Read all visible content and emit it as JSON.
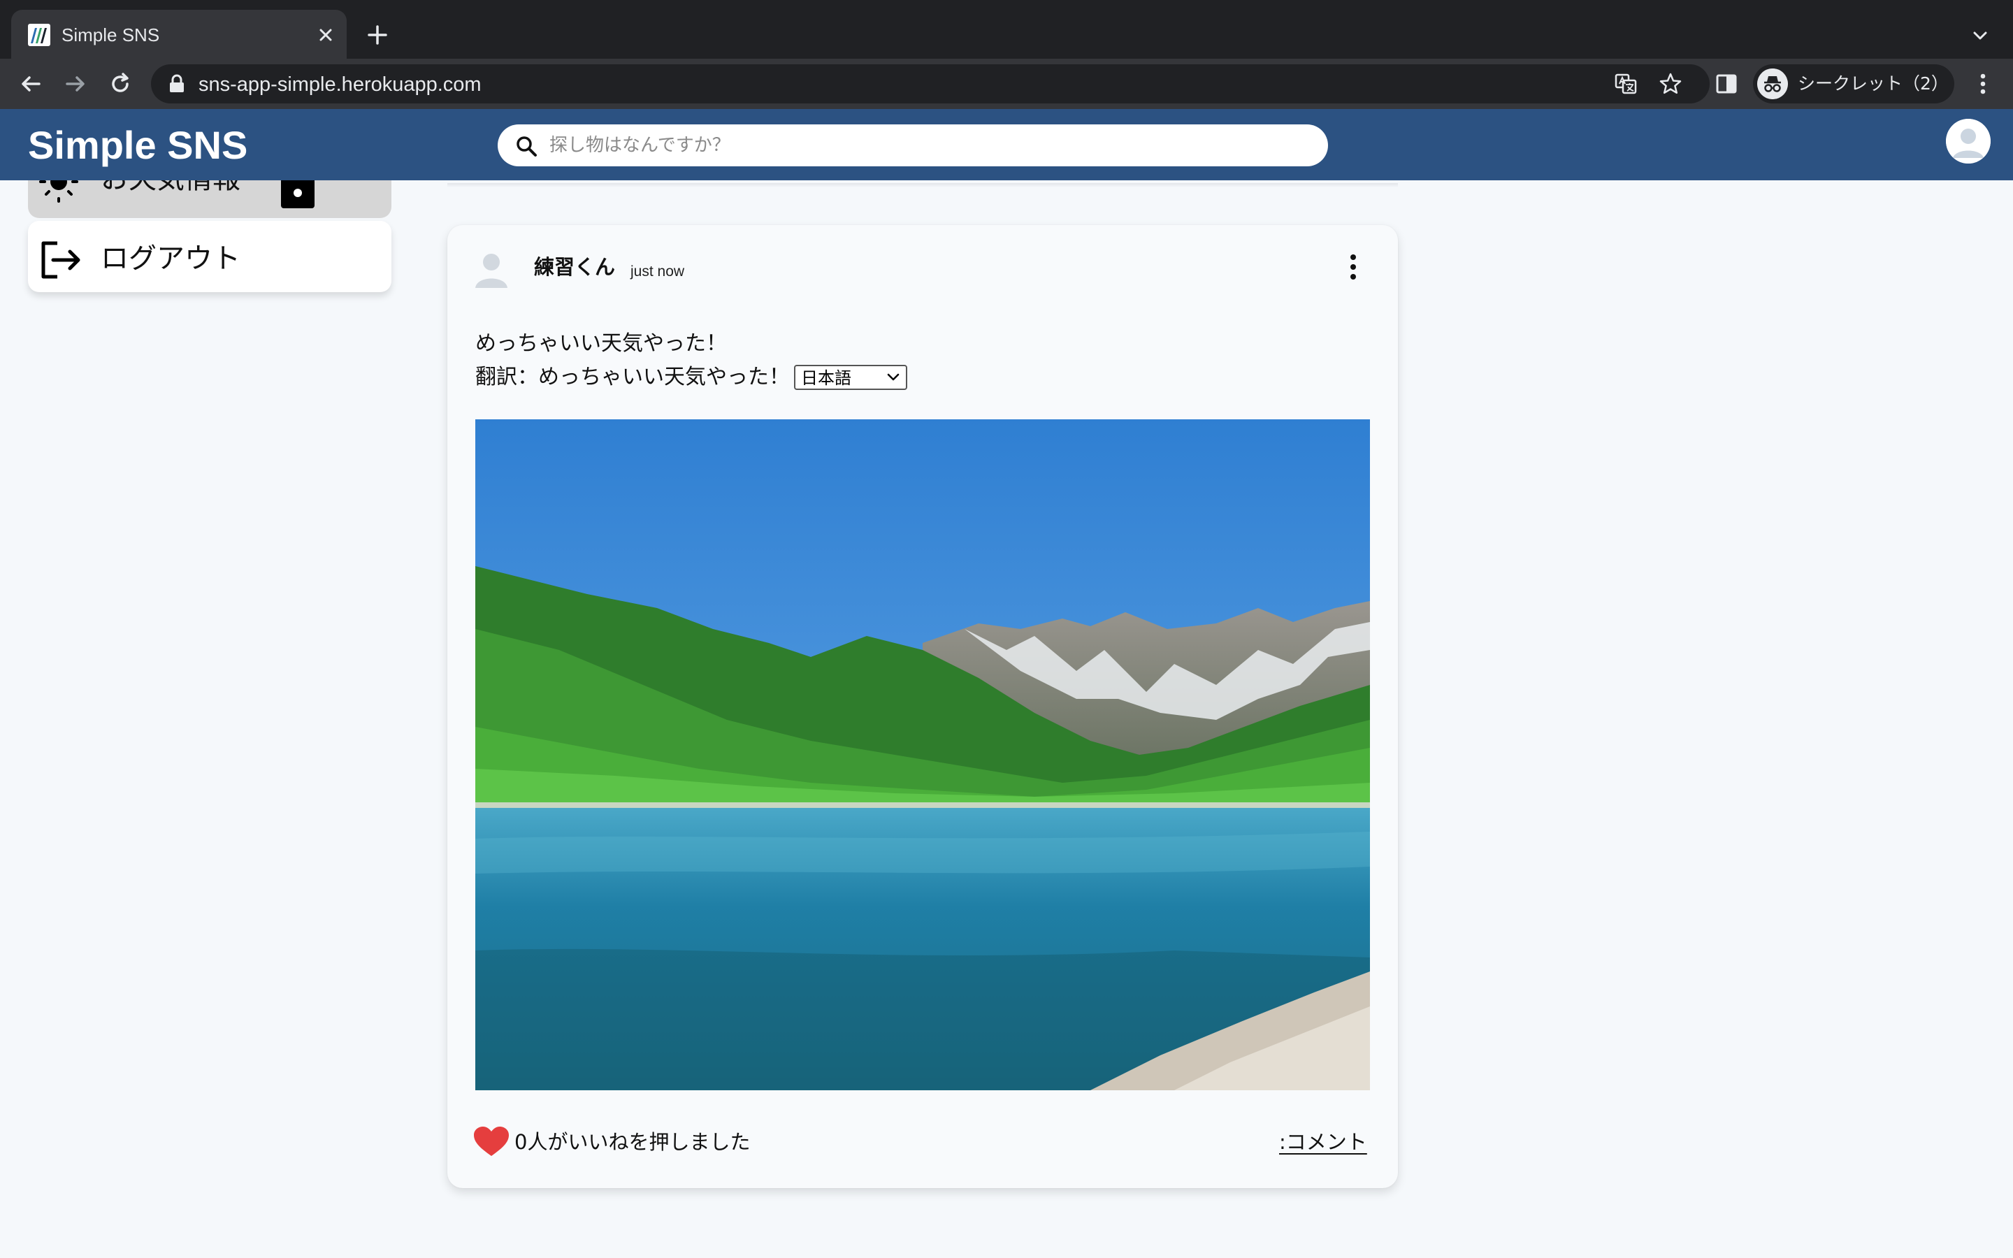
{
  "browser": {
    "tab_title": "Simple SNS",
    "url": "sns-app-simple.herokuapp.com",
    "incognito_label": "シークレット（2）"
  },
  "header": {
    "brand": "Simple SNS",
    "search_placeholder": "探し物はなんですか？",
    "accent_color": "#2c5282"
  },
  "sidebar": {
    "items": [
      {
        "label": "お天気情報",
        "icon": "sun-icon"
      },
      {
        "label": "ログアウト",
        "icon": "logout-icon"
      }
    ]
  },
  "post": {
    "author": "練習くん",
    "time": "just now",
    "text": "めっちゃいい天気やった！",
    "translation_label": "翻訳：めっちゃいい天気やった！",
    "language_selected": "日本語",
    "likes_text": "0人がいいねを押しました",
    "comment_link": ":コメント",
    "photo": "mountain-lake-photo",
    "like_color": "#e53e3e"
  }
}
